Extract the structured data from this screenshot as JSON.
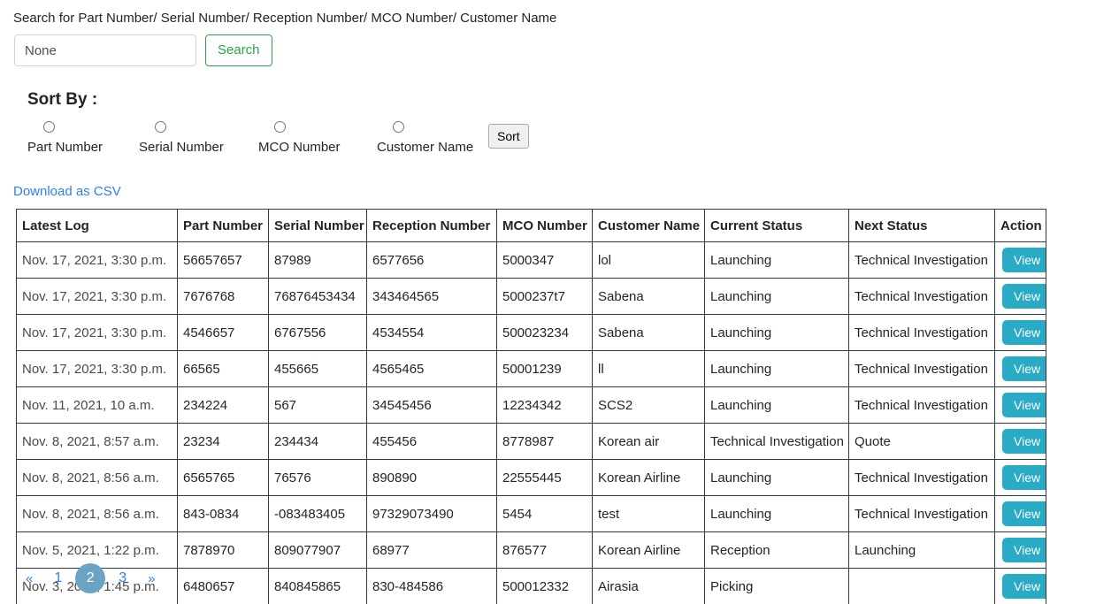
{
  "search": {
    "label": "Search for Part Number/ Serial Number/ Reception Number/ MCO Number/ Customer Name",
    "value": "None",
    "placeholder": "None",
    "button_label": "Search"
  },
  "sort": {
    "title": "Sort By :",
    "options": [
      {
        "label": "Part Number",
        "selected": false
      },
      {
        "label": "Serial Number",
        "selected": false
      },
      {
        "label": "MCO Number",
        "selected": false
      },
      {
        "label": "Customer Name",
        "selected": false
      }
    ],
    "button_label": "Sort"
  },
  "download": {
    "label": "Download as CSV"
  },
  "table": {
    "columns": [
      "Latest Log",
      "Part Number",
      "Serial Number",
      "Reception Number",
      "MCO Number",
      "Customer Name",
      "Current Status",
      "Next Status",
      "Action"
    ],
    "action_label": "View",
    "rows": [
      {
        "latest_log": "Nov. 17, 2021, 3:30 p.m.",
        "part_number": "56657657",
        "serial_number": "87989",
        "reception_number": "6577656",
        "mco_number": "5000347",
        "customer_name": "lol",
        "current_status": "Launching",
        "next_status": "Technical Investigation"
      },
      {
        "latest_log": "Nov. 17, 2021, 3:30 p.m.",
        "part_number": "7676768",
        "serial_number": "76876453434",
        "reception_number": "343464565",
        "mco_number": "5000237t7",
        "customer_name": "Sabena",
        "current_status": "Launching",
        "next_status": "Technical Investigation"
      },
      {
        "latest_log": "Nov. 17, 2021, 3:30 p.m.",
        "part_number": "4546657",
        "serial_number": "6767556",
        "reception_number": "4534554",
        "mco_number": "500023234",
        "customer_name": "Sabena",
        "current_status": "Launching",
        "next_status": "Technical Investigation"
      },
      {
        "latest_log": "Nov. 17, 2021, 3:30 p.m.",
        "part_number": "66565",
        "serial_number": "455665",
        "reception_number": "4565465",
        "mco_number": "50001239",
        "customer_name": "ll",
        "current_status": "Launching",
        "next_status": "Technical Investigation"
      },
      {
        "latest_log": "Nov. 11, 2021, 10 a.m.",
        "part_number": "234224",
        "serial_number": "567",
        "reception_number": "34545456",
        "mco_number": "12234342",
        "customer_name": "SCS2",
        "current_status": "Launching",
        "next_status": "Technical Investigation"
      },
      {
        "latest_log": "Nov. 8, 2021, 8:57 a.m.",
        "part_number": "23234",
        "serial_number": "234434",
        "reception_number": "455456",
        "mco_number": "8778987",
        "customer_name": "Korean air",
        "current_status": "Technical Investigation",
        "next_status": "Quote"
      },
      {
        "latest_log": "Nov. 8, 2021, 8:56 a.m.",
        "part_number": "6565765",
        "serial_number": "76576",
        "reception_number": "890890",
        "mco_number": "22555445",
        "customer_name": "Korean Airline",
        "current_status": "Launching",
        "next_status": "Technical Investigation"
      },
      {
        "latest_log": "Nov. 8, 2021, 8:56 a.m.",
        "part_number": "843-0834",
        "serial_number": "-083483405",
        "reception_number": "97329073490",
        "mco_number": "5454",
        "customer_name": "test",
        "current_status": "Launching",
        "next_status": "Technical Investigation"
      },
      {
        "latest_log": "Nov. 5, 2021, 1:22 p.m.",
        "part_number": "7878970",
        "serial_number": "809077907",
        "reception_number": "68977",
        "mco_number": "876577",
        "customer_name": "Korean Airline",
        "current_status": "Reception",
        "next_status": "Launching"
      },
      {
        "latest_log": "Nov. 3, 2021, 1:45 p.m.",
        "part_number": "6480657",
        "serial_number": "840845865",
        "reception_number": "830-484586",
        "mco_number": "500012332",
        "customer_name": "Airasia",
        "current_status": "Picking",
        "next_status": ""
      }
    ]
  },
  "pagination": {
    "first_label": "«",
    "last_label": "»",
    "pages": [
      "1",
      "2",
      "3"
    ],
    "active": "2"
  },
  "colors": {
    "view_button": "#29abc5",
    "search_button_border": "#28a745",
    "link": "#2d7ff9",
    "active_page": "#6ba3c4"
  }
}
